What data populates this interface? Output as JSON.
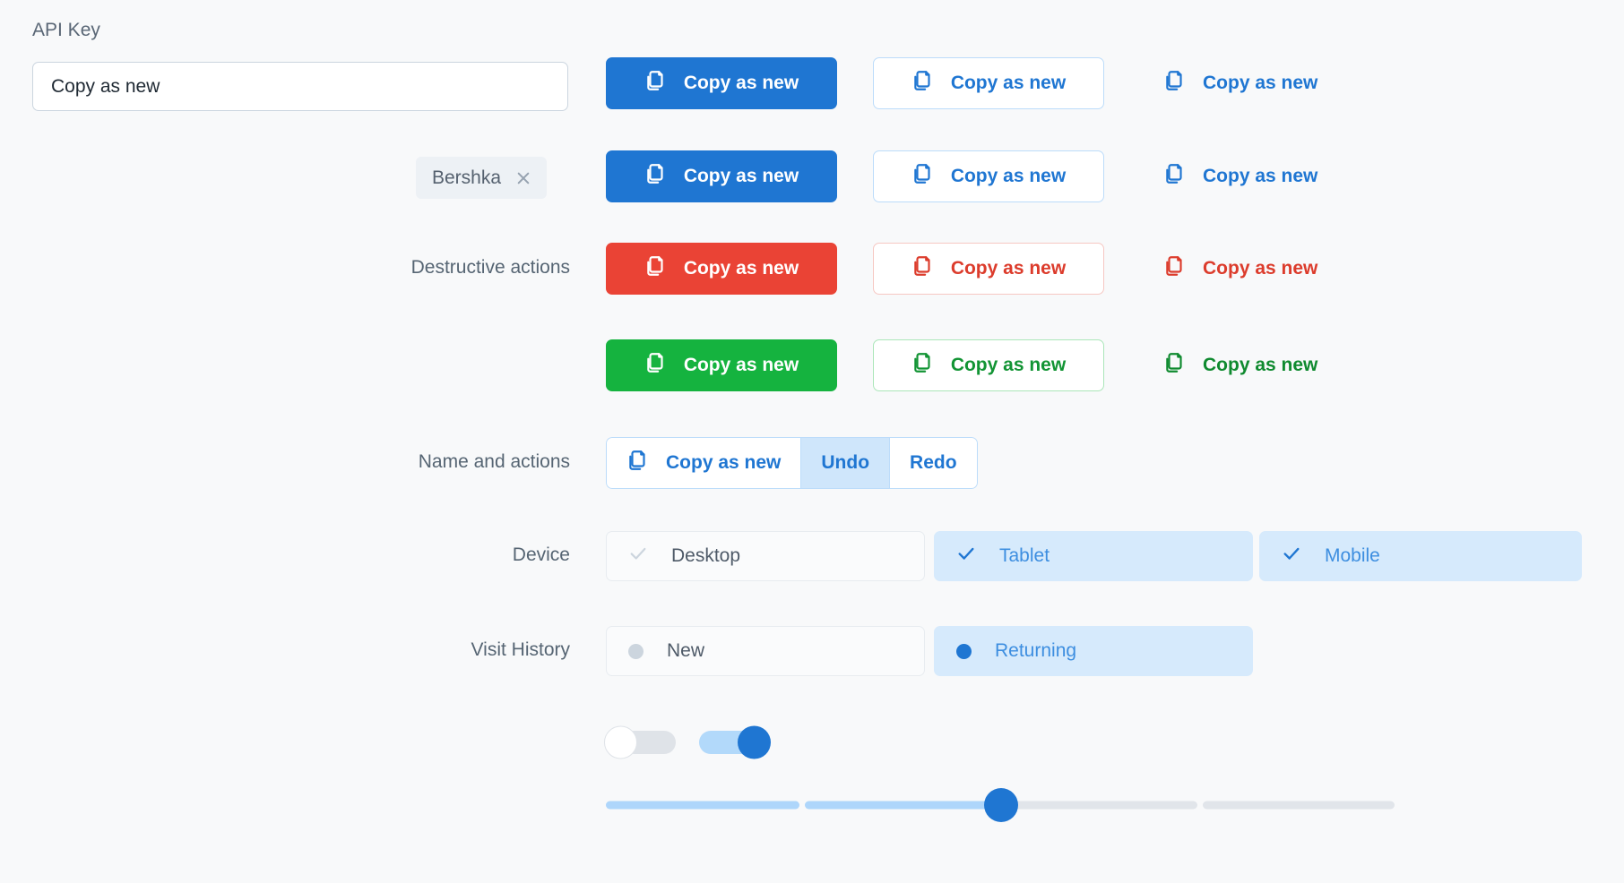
{
  "form": {
    "api_key": {
      "label": "API Key",
      "value": "Copy as new",
      "placeholder": "Copy as new"
    },
    "tag": {
      "label": "Bershka",
      "close_icon": "close-icon"
    },
    "labels": {
      "destructive": "Destructive actions",
      "name_and_actions": "Name and actions",
      "device": "Device",
      "visit_history": "Visit History"
    }
  },
  "buttons": {
    "copy_as_new": "Copy as new",
    "undo": "Undo",
    "redo": "Redo",
    "icon": "copy-icon"
  },
  "segmented": {
    "items": [
      {
        "label": "Copy as new",
        "active": false,
        "icon": "copy-icon"
      },
      {
        "label": "Undo",
        "active": true
      },
      {
        "label": "Redo",
        "active": false
      }
    ]
  },
  "device_options": [
    {
      "label": "Desktop",
      "selected": false
    },
    {
      "label": "Tablet",
      "selected": true
    },
    {
      "label": "Mobile",
      "selected": true
    }
  ],
  "visit_history_options": [
    {
      "label": "New",
      "selected": false
    },
    {
      "label": "Returning",
      "selected": true
    }
  ],
  "toggles": [
    {
      "state": "off"
    },
    {
      "state": "on"
    }
  ],
  "slider": {
    "value_percent": 50,
    "segments": [
      {
        "filled": true
      },
      {
        "filled": true
      },
      {
        "filled": false
      },
      {
        "filled": false
      }
    ]
  },
  "colors": {
    "primary": "#1f76d2",
    "danger": "#ea4335",
    "success": "#15b33f",
    "outline_blue": "#bcdcfa",
    "chip_selected_bg": "#d6eafc",
    "background": "#f8f9fa",
    "label_text": "#566573"
  }
}
